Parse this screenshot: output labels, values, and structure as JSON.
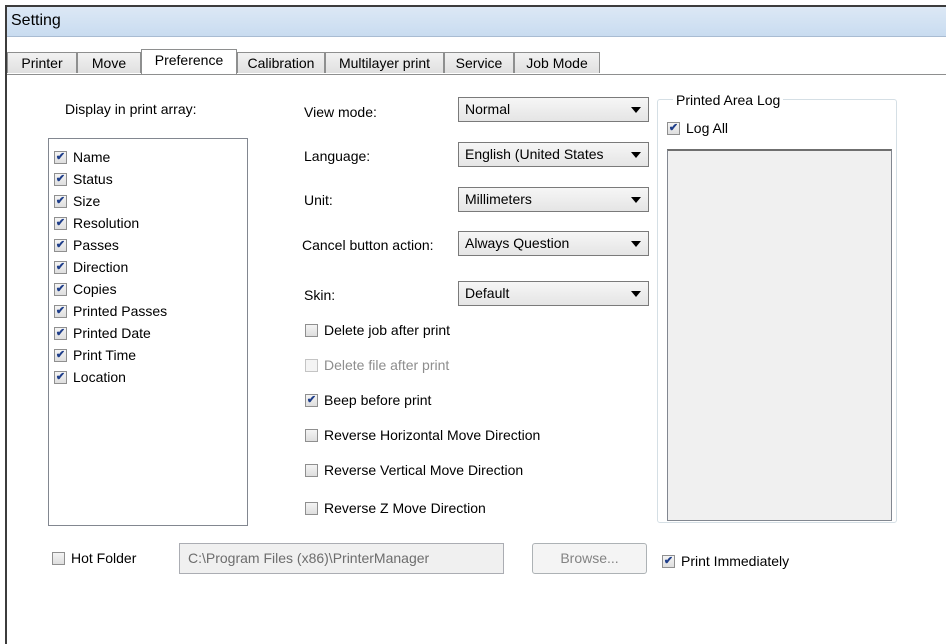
{
  "window": {
    "title": "Setting"
  },
  "tabs": [
    {
      "label": "Printer"
    },
    {
      "label": "Move"
    },
    {
      "label": "Preference"
    },
    {
      "label": "Calibration"
    },
    {
      "label": "Multilayer print"
    },
    {
      "label": "Service"
    },
    {
      "label": "Job Mode"
    }
  ],
  "display": {
    "heading": "Display in print array:",
    "items": [
      {
        "label": "Name",
        "checked": true
      },
      {
        "label": "Status",
        "checked": true
      },
      {
        "label": "Size",
        "checked": true
      },
      {
        "label": "Resolution",
        "checked": true
      },
      {
        "label": "Passes",
        "checked": true
      },
      {
        "label": "Direction",
        "checked": true
      },
      {
        "label": "Copies",
        "checked": true
      },
      {
        "label": "Printed Passes",
        "checked": true
      },
      {
        "label": "Printed Date",
        "checked": true
      },
      {
        "label": "Print Time",
        "checked": true
      },
      {
        "label": "Location",
        "checked": true
      }
    ]
  },
  "settings": {
    "view_mode": {
      "label": "View mode:",
      "value": "Normal"
    },
    "language": {
      "label": "Language:",
      "value": "English (United States"
    },
    "unit": {
      "label": "Unit:",
      "value": "Millimeters"
    },
    "cancel_action": {
      "label": "Cancel button action:",
      "value": "Always Question"
    },
    "skin": {
      "label": "Skin:",
      "value": "Default"
    }
  },
  "options": [
    {
      "label": "Delete job after print",
      "checked": false,
      "enabled": true
    },
    {
      "label": "Delete file after print",
      "checked": false,
      "enabled": false
    },
    {
      "label": "Beep before print",
      "checked": true,
      "enabled": true
    },
    {
      "label": "Reverse Horizontal Move Direction",
      "checked": false,
      "enabled": true
    },
    {
      "label": "Reverse Vertical Move Direction",
      "checked": false,
      "enabled": true
    },
    {
      "label": "Reverse Z Move Direction",
      "checked": false,
      "enabled": true
    }
  ],
  "printed_area_log": {
    "title": "Printed Area Log",
    "log_all_label": "Log All",
    "log_all_checked": true
  },
  "hot_folder": {
    "label": "Hot Folder",
    "checked": false,
    "path": "C:\\Program Files (x86)\\PrinterManager",
    "browse_label": "Browse...",
    "print_immediately_label": "Print Immediately",
    "print_immediately_checked": true
  }
}
